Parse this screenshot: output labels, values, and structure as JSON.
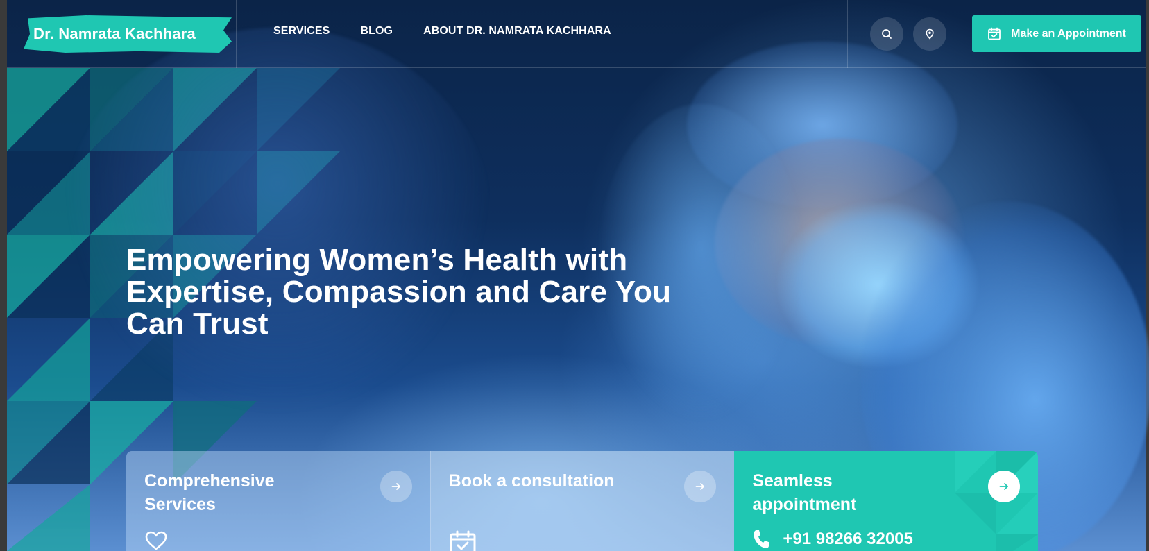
{
  "brand": {
    "name": "Dr. Namrata Kachhara",
    "accent_color": "#1fc7b2"
  },
  "nav": {
    "items": [
      {
        "label": "SERVICES"
      },
      {
        "label": "BLOG"
      },
      {
        "label": "ABOUT DR. NAMRATA KACHHARA"
      }
    ]
  },
  "header_actions": {
    "search_icon": "search-icon",
    "location_icon": "map-pin-icon",
    "appointment_label": "Make an Appointment",
    "appointment_icon": "calendar-check-icon"
  },
  "hero": {
    "headline": "Empowering Women’s Health with Expertise, Compassion and Care You Can Trust"
  },
  "cards": [
    {
      "title": "Comprehensive Services",
      "icon": "heart-icon",
      "arrow_icon": "arrow-right-icon"
    },
    {
      "title": "Book a consultation",
      "icon": "calendar-check-icon",
      "arrow_icon": "arrow-right-icon"
    },
    {
      "title": "Seamless appointment",
      "phone": "+91 98266 32005",
      "icon": "phone-icon",
      "arrow_icon": "arrow-right-icon"
    }
  ]
}
